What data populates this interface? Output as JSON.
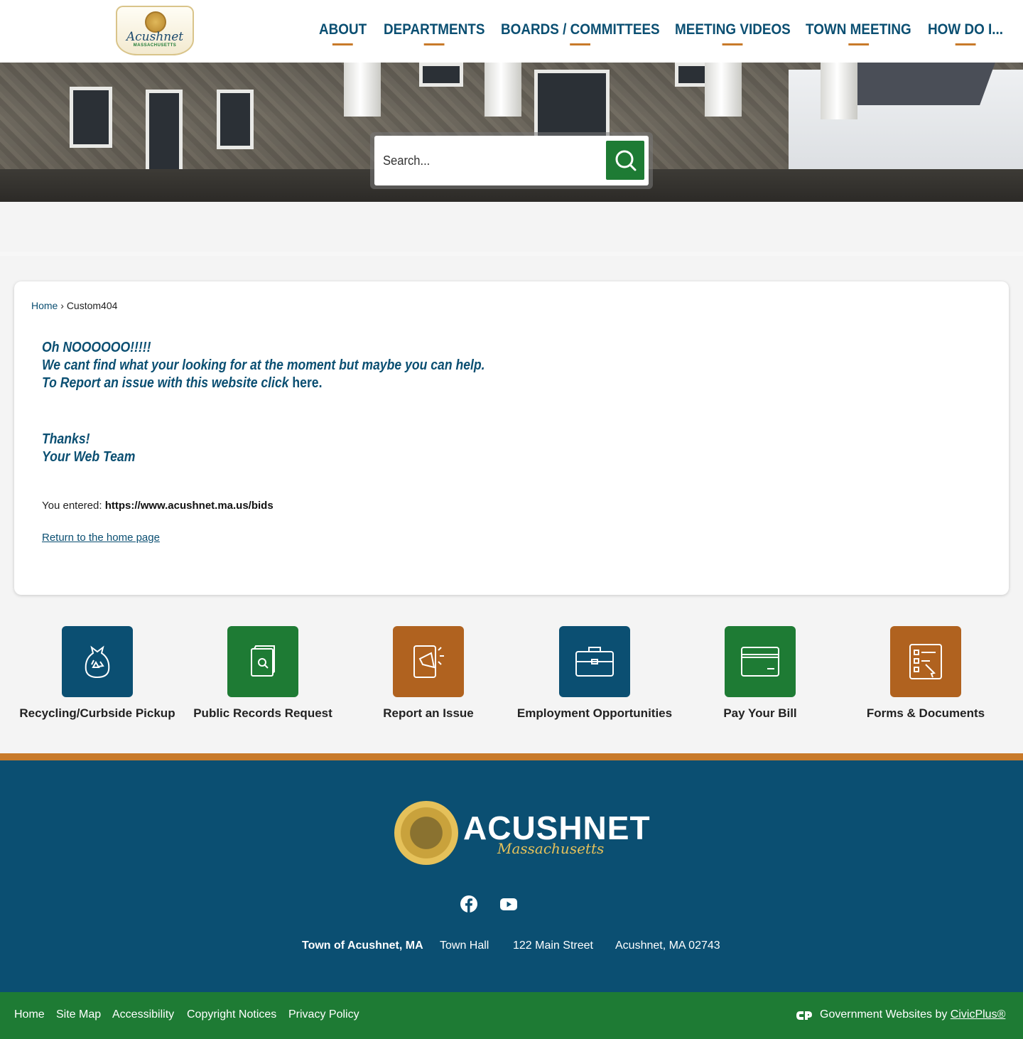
{
  "header": {
    "logo_text": "Acushnet",
    "logo_subtext": "MASSACHUSETTS",
    "nav": [
      {
        "label": "ABOUT"
      },
      {
        "label": "DEPARTMENTS"
      },
      {
        "label": "BOARDS / COMMITTEES"
      },
      {
        "label": "MEETING VIDEOS"
      },
      {
        "label": "TOWN MEETING"
      },
      {
        "label": "HOW DO I..."
      }
    ]
  },
  "search": {
    "placeholder": "Search..."
  },
  "breadcrumb": {
    "home": "Home",
    "separator": "›",
    "current": "Custom404"
  },
  "message": {
    "line1": "Oh NOOOOOO!!!!!",
    "line2": "We cant find what your looking for at the moment but maybe you can help.",
    "line3_prefix": "To Report an issue with this website click ",
    "line3_link": "here.",
    "thanks": "Thanks!",
    "team": "Your Web Team"
  },
  "entered": {
    "label": "You entered: ",
    "url": "https://www.acushnet.ma.us/bids"
  },
  "return_link": "Return to the home page",
  "quick_links": [
    {
      "label": "Recycling/Curbside Pickup",
      "icon": "recycling-bag-icon",
      "color": "#0b4f72"
    },
    {
      "label": "Public Records Request",
      "icon": "records-search-icon",
      "color": "#1e7b34"
    },
    {
      "label": "Report an Issue",
      "icon": "megaphone-tablet-icon",
      "color": "#b0621f"
    },
    {
      "label": "Employment Opportunities",
      "icon": "briefcase-icon",
      "color": "#0b4f72"
    },
    {
      "label": "Pay Your Bill",
      "icon": "credit-card-icon",
      "color": "#1e7b34"
    },
    {
      "label": "Forms & Documents",
      "icon": "form-checklist-icon",
      "color": "#b0621f"
    }
  ],
  "footer": {
    "town_name": "ACUSHNET",
    "state_script": "Massachusetts",
    "address": {
      "town": "Town of Acushnet, MA",
      "building": "Town Hall",
      "street": "122 Main Street",
      "city": "Acushnet, MA 02743"
    },
    "links": [
      "Home",
      "Site Map",
      "Accessibility",
      "Copyright Notices",
      "Privacy Policy"
    ],
    "credit_prefix": "Government Websites by ",
    "credit_link": "CivicPlus®"
  },
  "colors": {
    "brand_blue": "#0b4f72",
    "brand_green": "#1e7b34",
    "brand_orange": "#c87a2a"
  }
}
